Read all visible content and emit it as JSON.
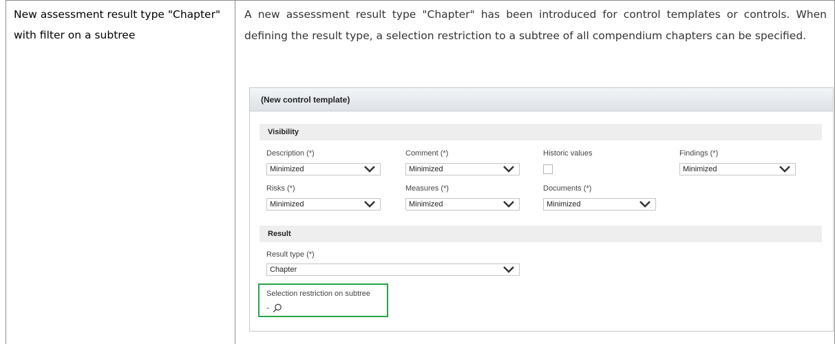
{
  "left_title": "New assessment result type \"Chapter\" with filter on a subtree",
  "description": "A new assessment result type \"Chapter\" has been introduced for control templates or controls. When defining the result type, a selection restriction to a subtree of all compendium chapters can be specified.",
  "panel": {
    "title": "(New control template)",
    "visibility": {
      "heading": "Visibility",
      "description": {
        "label": "Description (*)",
        "value": "Minimized"
      },
      "comment": {
        "label": "Comment (*)",
        "value": "Minimized"
      },
      "historic": {
        "label": "Historic values"
      },
      "findings": {
        "label": "Findings (*)",
        "value": "Minimized"
      },
      "risks": {
        "label": "Risks (*)",
        "value": "Minimized"
      },
      "measures": {
        "label": "Measures (*)",
        "value": "Minimized"
      },
      "documents": {
        "label": "Documents (*)",
        "value": "Minimized"
      }
    },
    "result": {
      "heading": "Result",
      "result_type": {
        "label": "Result type (*)",
        "value": "Chapter"
      },
      "subtree": {
        "label": "Selection restriction on subtree",
        "value": "-"
      }
    }
  },
  "icons": [
    "chevron-down-icon",
    "search-icon"
  ],
  "colors": {
    "highlight": "#25a446",
    "section_bg": "#eeeeee",
    "header_bg": "#dde2e7"
  }
}
